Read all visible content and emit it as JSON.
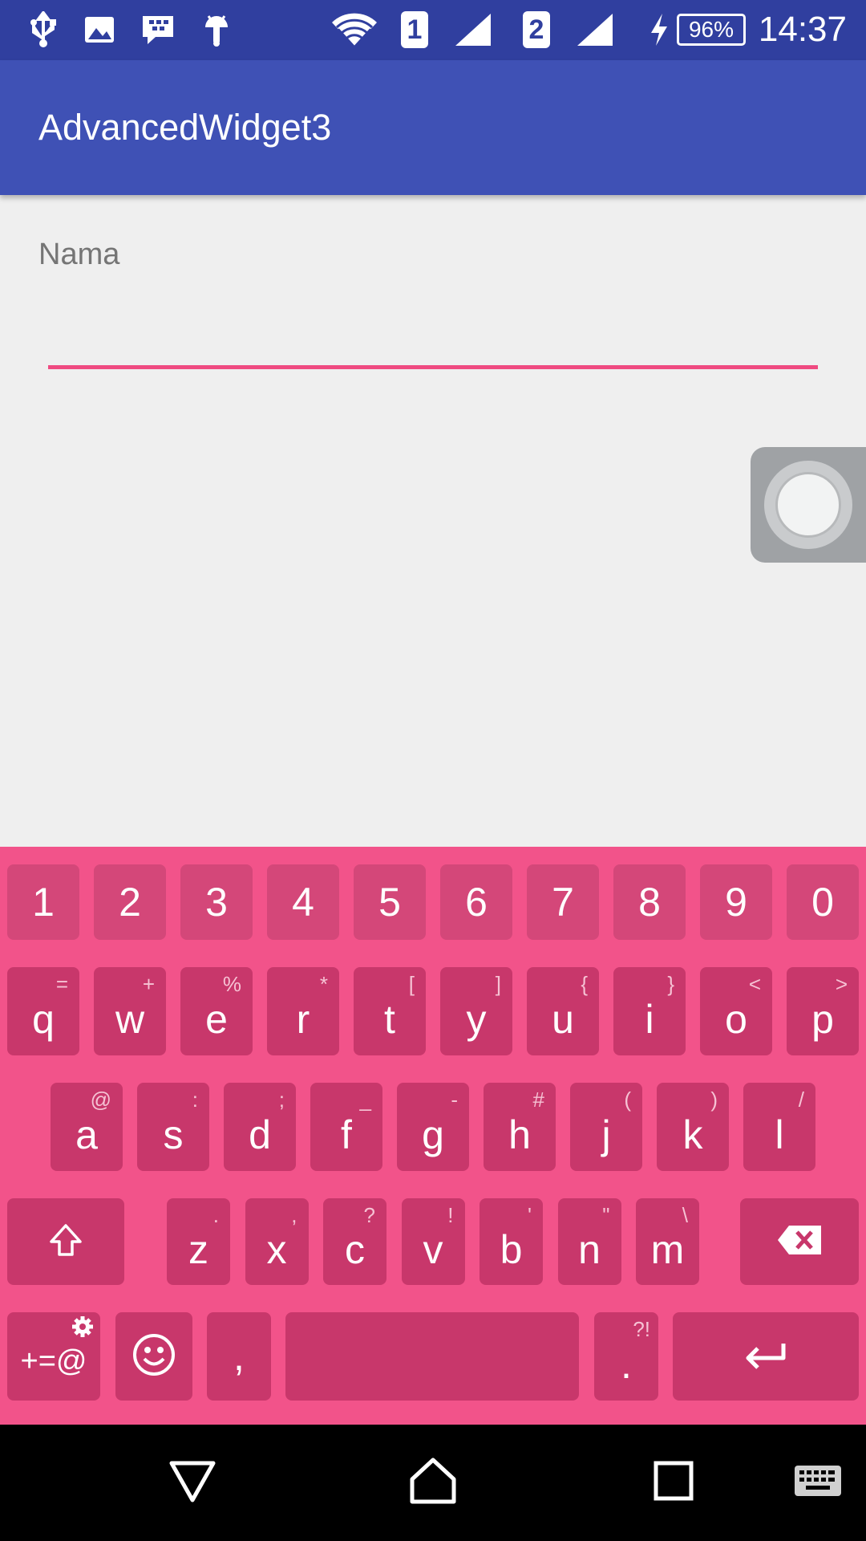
{
  "status_bar": {
    "time": "14:37",
    "battery": "96%",
    "sim1": "1",
    "sim2": "2",
    "icons": [
      "usb-icon",
      "image-icon",
      "bbm-icon",
      "android-icon",
      "wifi-icon",
      "signal-icon",
      "charging-icon"
    ]
  },
  "app_bar": {
    "title": "AdvancedWidget3"
  },
  "form": {
    "name_label": "Nama",
    "name_value": ""
  },
  "colors": {
    "status_bar": "#303f9f",
    "app_bar": "#3f51b5",
    "accent": "#ef4a81",
    "keyboard_bg": "#f2538a",
    "key_bg": "#c8376b"
  },
  "keyboard": {
    "row_numbers": [
      "1",
      "2",
      "3",
      "4",
      "5",
      "6",
      "7",
      "8",
      "9",
      "0"
    ],
    "row1": [
      {
        "k": "q",
        "s": "="
      },
      {
        "k": "w",
        "s": "+"
      },
      {
        "k": "e",
        "s": "%"
      },
      {
        "k": "r",
        "s": "*"
      },
      {
        "k": "t",
        "s": "["
      },
      {
        "k": "y",
        "s": "]"
      },
      {
        "k": "u",
        "s": "{"
      },
      {
        "k": "i",
        "s": "}"
      },
      {
        "k": "o",
        "s": "<"
      },
      {
        "k": "p",
        "s": ">"
      }
    ],
    "row2": [
      {
        "k": "a",
        "s": "@"
      },
      {
        "k": "s",
        "s": ":"
      },
      {
        "k": "d",
        "s": ";"
      },
      {
        "k": "f",
        "s": "_"
      },
      {
        "k": "g",
        "s": "-"
      },
      {
        "k": "h",
        "s": "#"
      },
      {
        "k": "j",
        "s": "("
      },
      {
        "k": "k",
        "s": ")"
      },
      {
        "k": "l",
        "s": "/"
      }
    ],
    "row3": [
      {
        "k": "z",
        "s": "."
      },
      {
        "k": "x",
        "s": ","
      },
      {
        "k": "c",
        "s": "?"
      },
      {
        "k": "v",
        "s": "!"
      },
      {
        "k": "b",
        "s": "'"
      },
      {
        "k": "n",
        "s": "\""
      },
      {
        "k": "m",
        "s": "\\"
      }
    ],
    "symbols_key": "+=@",
    "comma_key": ",",
    "period_key": ".",
    "period_sub": "?!"
  }
}
